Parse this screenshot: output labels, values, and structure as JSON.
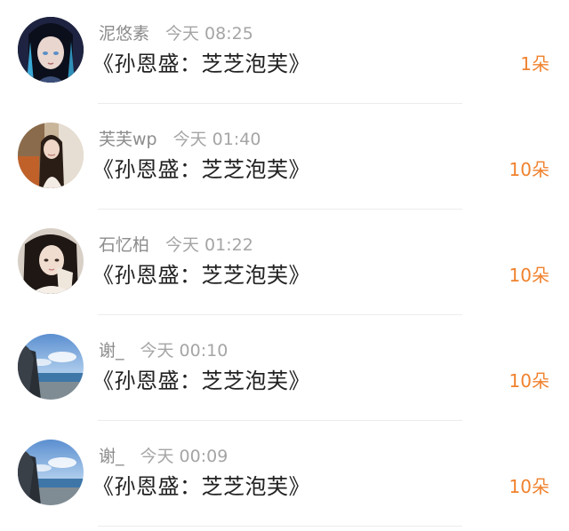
{
  "items": [
    {
      "name": "泥悠素",
      "time": "今天 08:25",
      "title": "《孙恩盛：芝芝泡芙》",
      "count": "1朵",
      "avatar": "anime-portrait"
    },
    {
      "name": "芙芙wp",
      "time": "今天 01:40",
      "title": "《孙恩盛：芝芝泡芙》",
      "count": "10朵",
      "avatar": "girl-in-car-portrait"
    },
    {
      "name": "石忆柏",
      "time": "今天 01:22",
      "title": "《孙恩盛：芝芝泡芙》",
      "count": "10朵",
      "avatar": "girl-selfie-portrait"
    },
    {
      "name": "谢_",
      "time": "今天 00:10",
      "title": "《孙恩盛：芝芝泡芙》",
      "count": "10朵",
      "avatar": "beach-sky-photo"
    },
    {
      "name": "谢_",
      "time": "今天 00:09",
      "title": "《孙恩盛：芝芝泡芙》",
      "count": "10朵",
      "avatar": "beach-sky-photo"
    }
  ],
  "colors": {
    "count": "#f0822e",
    "meta": "#9a9a9a",
    "title": "#222222",
    "divider": "#ececec"
  }
}
